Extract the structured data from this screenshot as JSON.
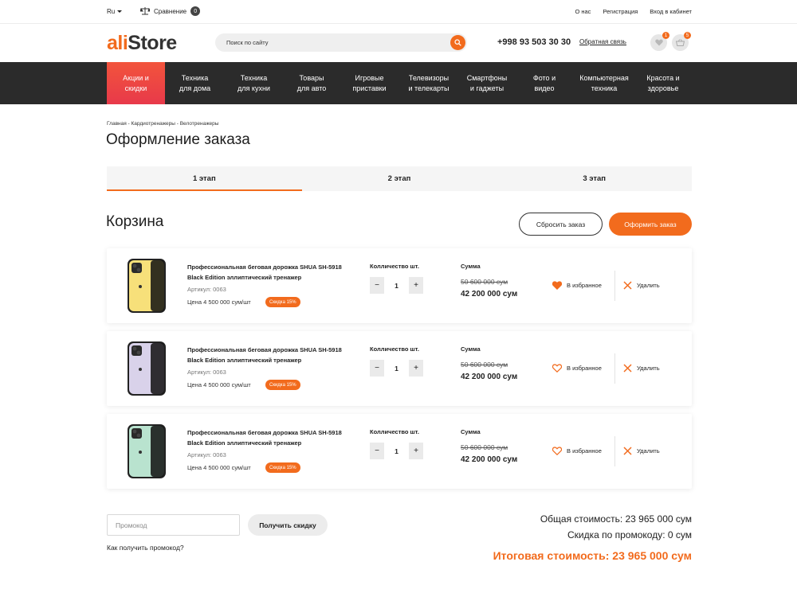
{
  "topbar": {
    "lang": "Ru",
    "compare_label": "Сравнение",
    "compare_count": "0",
    "links": [
      "О нас",
      "Регистрация",
      "Вход в кабинет"
    ]
  },
  "header": {
    "logo_part1": "ali",
    "logo_part2": "Store",
    "search_placeholder": "Поиск по сайту",
    "phone": "+998 93 503 30 30",
    "callback": "Обратная связь",
    "wishlist_count": "1",
    "cart_count": "5"
  },
  "nav": {
    "items": [
      "Акции и\nскидки",
      "Техника\nдля дома",
      "Техника\nдля кухни",
      "Товары\nдля авто",
      "Игровые\nприставки",
      "Телевизоры\nи телекарты",
      "Смартфоны\nи гаджеты",
      "Фото и\nвидео",
      "Компьютерная\nтехника",
      "Красота и\nздоровье"
    ]
  },
  "breadcrumb": "Главная - Кардиотренажеры - Велотренажеры",
  "page_title": "Оформление заказа",
  "steps": [
    "1 этап",
    "2 этап",
    "3 этап"
  ],
  "cart": {
    "title": "Корзина",
    "reset_label": "Сбросить заказ",
    "order_label": "Оформить заказ",
    "items": [
      {
        "name": "Профессиональная беговая дорожка SHUA SH-5918 Black Edition эллиптический тренажер",
        "sku": "Артикул: 0063",
        "price": "Цена 4 500 000 сум/шт",
        "discount": "Скидка 15%",
        "qty_label": "Колличество шт.",
        "qty": "1",
        "sum_label": "Сумма",
        "old_price": "50 600 000 сум",
        "new_price": "42 200 000 сум",
        "fav_label": "В избранное",
        "delete_label": "Удалить",
        "favorited": true,
        "color": "#f7e07a"
      },
      {
        "name": "Профессиональная беговая дорожка SHUA SH-5918 Black Edition эллиптический тренажер",
        "sku": "Артикул: 0063",
        "price": "Цена 4 500 000 сум/шт",
        "discount": "Скидка 15%",
        "qty_label": "Колличество шт.",
        "qty": "1",
        "sum_label": "Сумма",
        "old_price": "50 600 000 сум",
        "new_price": "42 200 000 сум",
        "fav_label": "В избранное",
        "delete_label": "Удалить",
        "favorited": false,
        "color": "#d9d2ea"
      },
      {
        "name": "Профессиональная беговая дорожка SHUA SH-5918 Black Edition эллиптический тренажер",
        "sku": "Артикул: 0063",
        "price": "Цена 4 500 000 сум/шт",
        "discount": "Скидка 15%",
        "qty_label": "Колличество шт.",
        "qty": "1",
        "sum_label": "Сумма",
        "old_price": "50 600 000 сум",
        "new_price": "42 200 000 сум",
        "fav_label": "В избранное",
        "delete_label": "Удалить",
        "favorited": false,
        "color": "#b9e3cf"
      }
    ]
  },
  "promo": {
    "placeholder": "Промокод",
    "button": "Получить скидку",
    "link": "Как получить промокод?"
  },
  "totals": {
    "total": "Общая стоимость: 23 965 000 сум",
    "promo_discount": "Скидка по промокоду: 0 сум",
    "grand_total": "Итоговая стоимость: 23 965 000 сум"
  },
  "colors": {
    "accent": "#f26b1d",
    "nav_bg": "#2b2b2b",
    "nav_active": "#ee4a42"
  }
}
